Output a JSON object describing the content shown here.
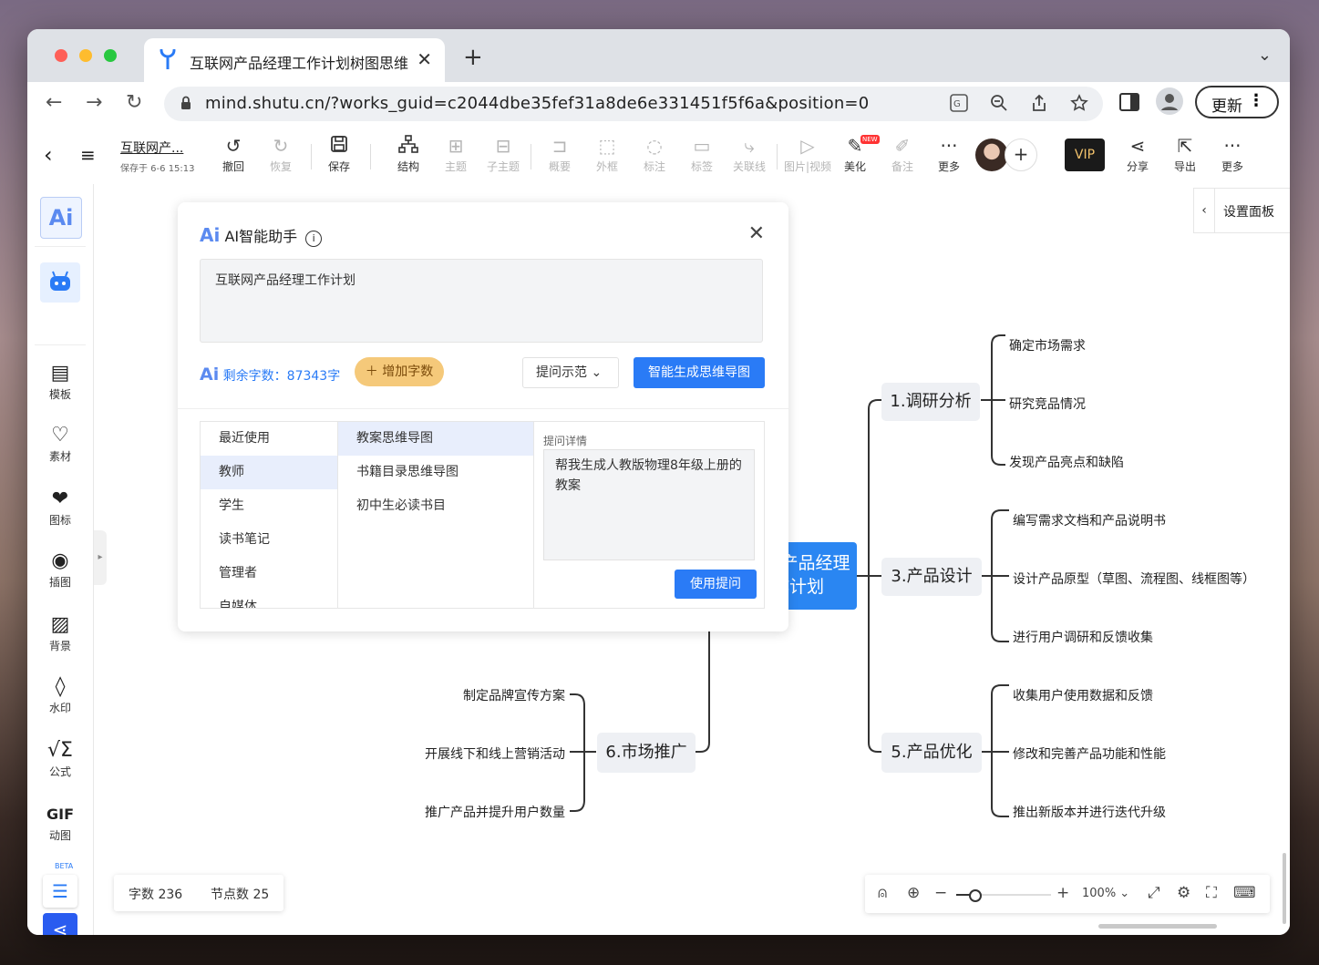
{
  "browser": {
    "tab_title": "互联网产品经理工作计划树图思维",
    "url": "mind.shutu.cn/?works_guid=c2044dbe35fef31a8de6e331451f5f6a&position=0",
    "update_label": "更新"
  },
  "doc": {
    "title": "互联网产...",
    "saved": "保存于 6-6 15:13"
  },
  "toolbar": {
    "undo": "撤回",
    "redo": "恢复",
    "save": "保存",
    "structure": "结构",
    "topic": "主题",
    "subtopic": "子主题",
    "summary": "概要",
    "frame": "外框",
    "note_mark": "标注",
    "tag": "标签",
    "relation": "关联线",
    "media": "图片|视频",
    "beautify": "美化",
    "new_badge": "NEW",
    "remark": "备注",
    "more1": "更多",
    "vip": "VIP",
    "share": "分享",
    "export": "导出",
    "more2": "更多"
  },
  "sidebar": {
    "template": "模板",
    "material": "素材",
    "icon": "图标",
    "illustration": "插图",
    "background": "背景",
    "watermark": "水印",
    "formula": "公式",
    "gif": "动图",
    "gif_glyph": "GIF",
    "beta": "BETA"
  },
  "ai_panel": {
    "title": "AI智能助手",
    "input_text": "互联网产品经理工作计划",
    "remaining": "剩余字数：87343字",
    "add_words": "增加字数",
    "prompt_examples": "提问示范",
    "generate": "智能生成思维导图",
    "categories": [
      "最近使用",
      "教师",
      "学生",
      "读书笔记",
      "管理者",
      "自媒体"
    ],
    "templates": [
      "教案思维导图",
      "书籍目录思维导图",
      "初中生必读书目"
    ],
    "detail_label": "提问详情",
    "detail_text": "帮我生成人教版物理8年级上册的教案",
    "use_prompt": "使用提问"
  },
  "settings_panel": "设置面板",
  "mindmap": {
    "center": "互联网产品经理工作计划",
    "b1": {
      "title": "1.调研分析",
      "items": [
        "确定市场需求",
        "研究竞品情况",
        "发现产品亮点和缺陷"
      ]
    },
    "b3": {
      "title": "3.产品设计",
      "items": [
        "编写需求文档和产品说明书",
        "设计产品原型（草图、流程图、线框图等）",
        "进行用户调研和反馈收集"
      ]
    },
    "b5": {
      "title": "5.产品优化",
      "items": [
        "收集用户使用数据和反馈",
        "修改和完善产品功能和性能",
        "推出新版本并进行迭代升级"
      ]
    },
    "b6": {
      "title": "6.市场推广",
      "items": [
        "制定品牌宣传方案",
        "开展线下和线上营销活动",
        "推广产品并提升用户数量"
      ]
    }
  },
  "stats": {
    "words": "字数 236",
    "nodes": "节点数 25"
  },
  "zoom": {
    "level": "100%"
  }
}
